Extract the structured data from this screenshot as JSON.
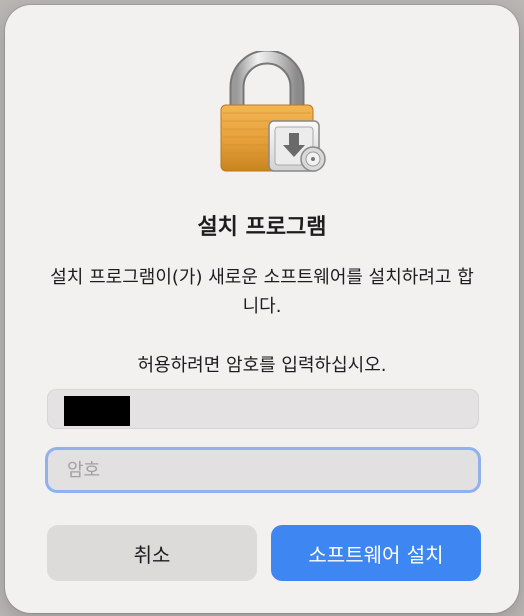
{
  "dialog": {
    "icon": "lock-with-installer-icon",
    "title": "설치 프로그램",
    "message": "설치 프로그램이(가) 새로운 소프트웨어를 설치하려고 합니다.",
    "prompt": "허용하려면 암호를 입력하십시오.",
    "username_redacted": true,
    "password_placeholder": "암호",
    "cancel_label": "취소",
    "install_label": "소프트웨어 설치"
  },
  "colors": {
    "accent": "#3e86f1",
    "focus_ring": "#8fb1ee",
    "dialog_bg": "#f3f1f0"
  }
}
